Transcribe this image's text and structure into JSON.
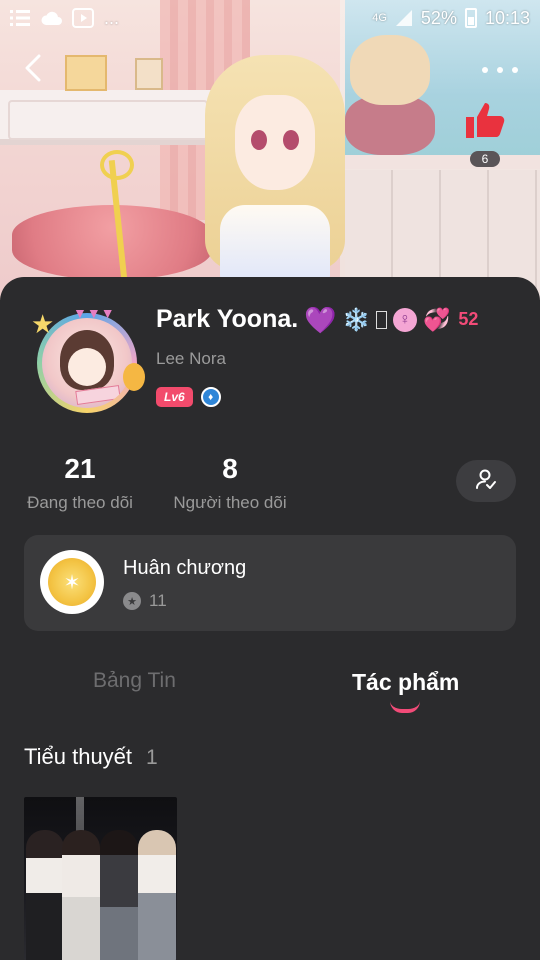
{
  "status_bar": {
    "network": "4G",
    "battery": "52%",
    "time": "10:13",
    "overflow": "..."
  },
  "header": {
    "like_count": "6"
  },
  "profile": {
    "name": "Park Yoona.",
    "name_emojis": [
      "💜",
      "❄️",
      "♀",
      "💞"
    ],
    "popularity": "52",
    "username": "Lee Nora",
    "level": "Lv6"
  },
  "stats": {
    "following_count": "21",
    "following_label": "Đang theo dõi",
    "followers_count": "8",
    "followers_label": "Người theo dõi"
  },
  "medals": {
    "title": "Huân chương",
    "count": "11"
  },
  "tabs": [
    {
      "label": "Bảng Tin",
      "active": false
    },
    {
      "label": "Tác phẩm",
      "active": true
    }
  ],
  "works": {
    "section_title": "Tiểu thuyết",
    "count": "1"
  },
  "colors": {
    "accent": "#f24b78",
    "sheet_bg": "#2b2b2d",
    "card_bg": "#3a3a3c",
    "muted_text": "#9a9a9a"
  }
}
